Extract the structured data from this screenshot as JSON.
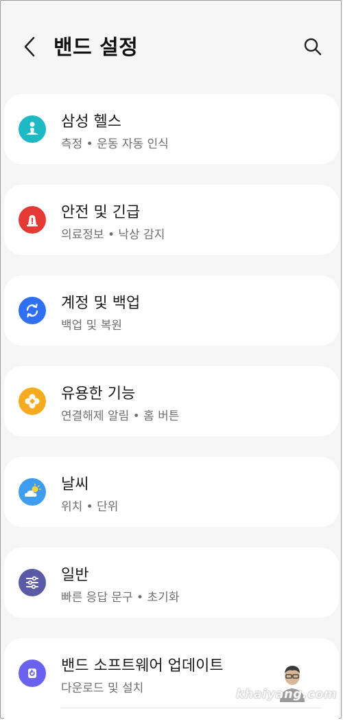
{
  "header": {
    "title": "밴드 설정",
    "back_icon": "chevron-left-icon",
    "search_icon": "search-icon"
  },
  "items": [
    {
      "title": "삼성 헬스",
      "subtitle": "측정 • 운동 자동 인식",
      "icon": "health-icon",
      "color": "#1fb9c4"
    },
    {
      "title": "안전 및 긴급",
      "subtitle": "의료정보 • 낙상 감지",
      "icon": "emergency-icon",
      "color": "#e53a33"
    },
    {
      "title": "계정 및 백업",
      "subtitle": "백업 및 복원",
      "icon": "sync-icon",
      "color": "#2f6ff2"
    },
    {
      "title": "유용한 기능",
      "subtitle": "연결해제 알림 • 홈 버튼",
      "icon": "feature-icon",
      "color": "#f6aa1f"
    },
    {
      "title": "날씨",
      "subtitle": "위치 • 단위",
      "icon": "weather-icon",
      "color": "#3f9df0"
    },
    {
      "title": "일반",
      "subtitle": "빠른 응답 문구 • 초기화",
      "icon": "sliders-icon",
      "color": "#5a5aa6"
    },
    {
      "title": "밴드 소프트웨어 업데이트",
      "subtitle": "다운로드 및 설치",
      "icon": "update-icon",
      "color": "#6a62ee"
    }
  ],
  "watermark": {
    "text": "khaiyang.com"
  }
}
